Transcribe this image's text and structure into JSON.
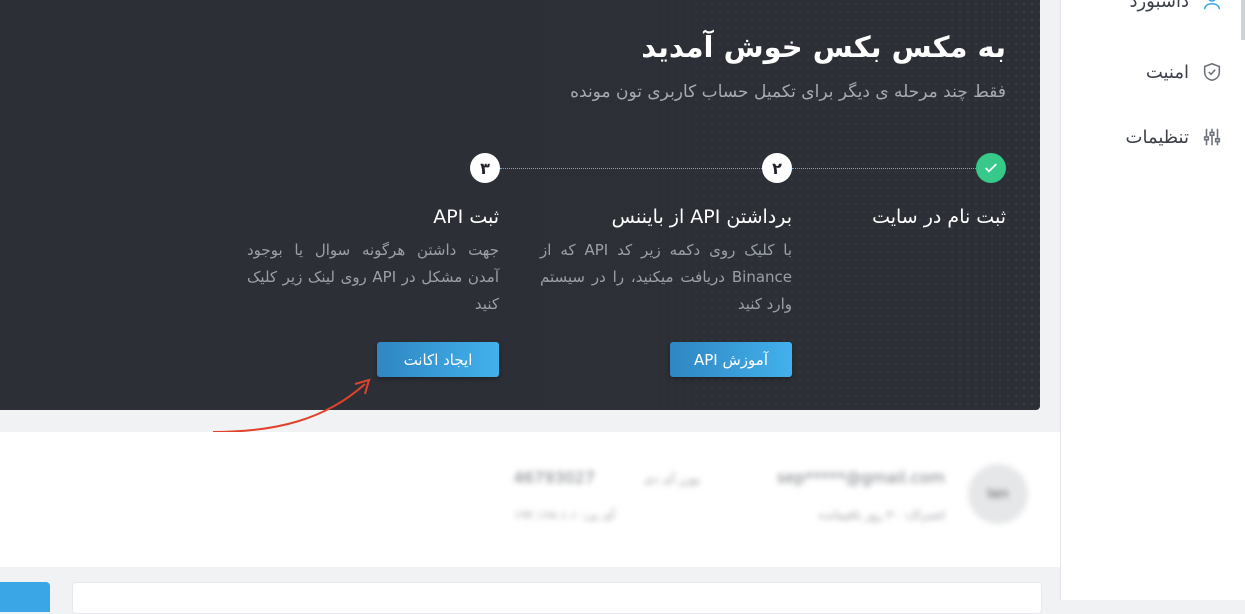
{
  "sidebar": {
    "items": [
      {
        "label": "داشبورد",
        "icon": "user-icon"
      },
      {
        "label": "امنیت",
        "icon": "shield-icon"
      },
      {
        "label": "تنظیمات",
        "icon": "sliders-icon"
      }
    ]
  },
  "hero": {
    "title": "به مکس بکس خوش آمدید",
    "subtitle": "فقط چند مرحله ی دیگر برای تکمیل حساب کاربری تون مونده",
    "steps": [
      {
        "number": "✓",
        "state": "done",
        "title": "ثبت نام در سایت",
        "description": ""
      },
      {
        "number": "۲",
        "state": "pending",
        "title": "برداشتن API از بایننس",
        "description": "با کلیک روی دکمه زیر کد API که از Binance دریافت میکنید، را در سیستم وارد کنید",
        "button": "آموزش API"
      },
      {
        "number": "۳",
        "state": "pending",
        "title": "ثبت API",
        "description": "جهت داشتن هرگونه سوال یا بوجود آمدن مشکل در API روی لینک زیر کلیک کنید",
        "button": "ایجاد اکانت"
      }
    ]
  },
  "profile": {
    "avatar_text": "ten",
    "email": "sep*****@gmail.com",
    "user_id_label": "یوزر آی دی",
    "user_id": "46793027",
    "line2_a": "اشتراک: ۳۰ روز باقیمانده",
    "line2_b": "آی پی: ۱۹۲.۱۶۸.۱.۱"
  },
  "colors": {
    "hero_bg": "#2c2f36",
    "accent": "#3aa6e6",
    "success": "#36c98a"
  }
}
